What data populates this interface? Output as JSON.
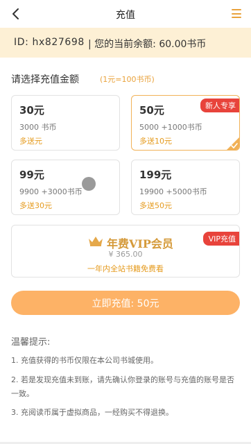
{
  "header": {
    "title": "充值",
    "back_icon": "chevron-left-icon",
    "menu_icon": "hamburger-menu-icon",
    "accent_color": "#e9a23b"
  },
  "account": {
    "id_text": "ID: hx827698",
    "balance_text": "| 您的当前余额: 60.00书币",
    "bar_color": "#fdf0d5"
  },
  "recharge": {
    "title": "请选择充值金额",
    "rate_note": "(1元=100书币)",
    "options": [
      {
        "amount": "30元",
        "coins": "3000 书币",
        "bonus": "多送元",
        "selected": false
      },
      {
        "amount": "50元",
        "coins": "5000 +1000书币",
        "bonus": "多送10元",
        "selected": true,
        "tag": "新人专享"
      },
      {
        "amount": "99元",
        "coins": "9900 +3000书币",
        "bonus": "多送30元",
        "selected": false
      },
      {
        "amount": "199元",
        "coins": "19900 +5000书币",
        "bonus": "多送50元",
        "selected": false
      }
    ],
    "vip": {
      "title": "年费VIP会员",
      "price": "¥ 365.00",
      "desc": "一年内全站书籍免费看",
      "tag": "VIP充值",
      "icon": "crown-icon"
    },
    "pay_button_label": "立即充值: 50元",
    "pay_button_color": "#fdb266"
  },
  "tips": {
    "title": "温馨提示:",
    "items": [
      "1. 充值获得的书币仅限在本公司书城使用。",
      "2. 若是发现充值未到账，请先确认你登录的账号与充值的账号是否一致。",
      "3. 充阅读币属于虚拟商品，一经购买不得退换。"
    ]
  }
}
